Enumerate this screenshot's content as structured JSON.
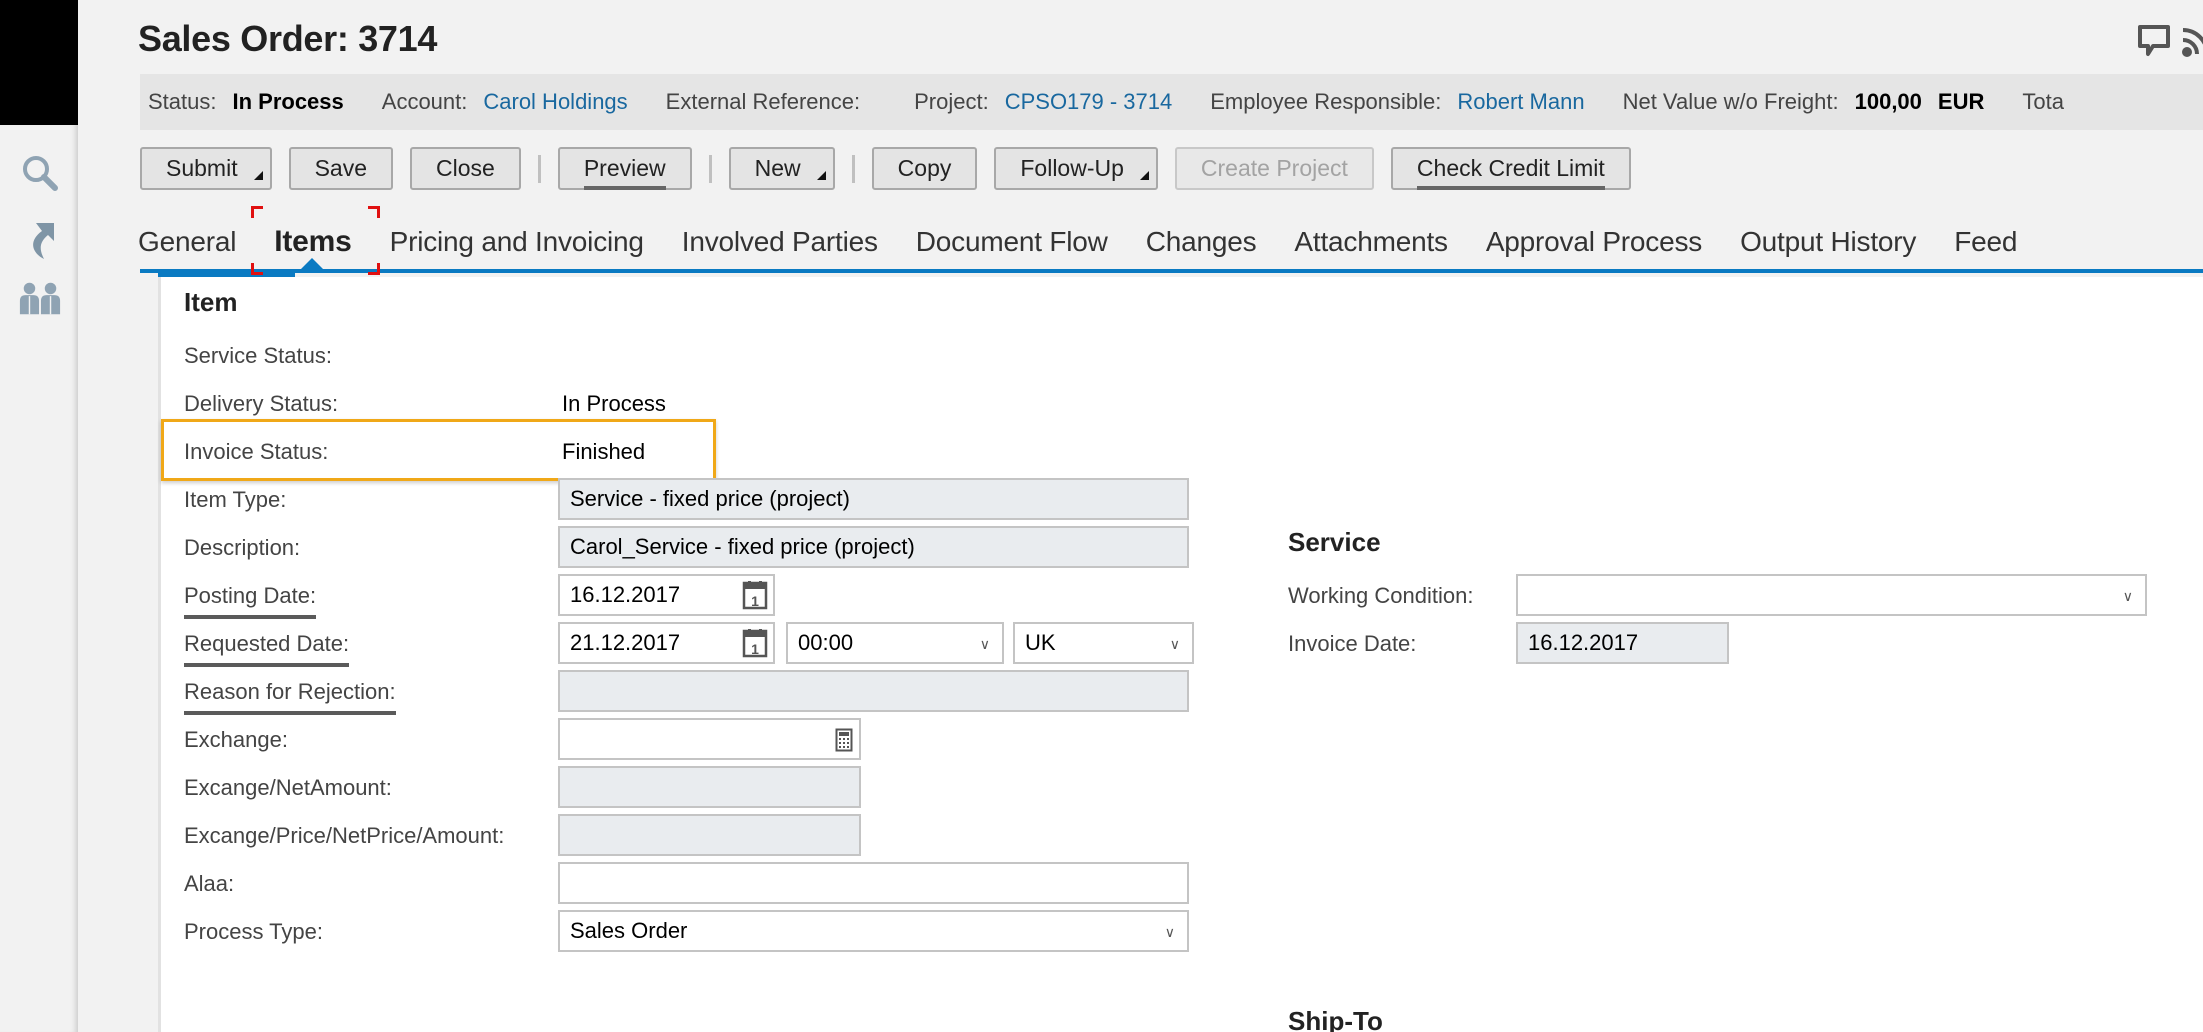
{
  "title": "Sales Order: 3714",
  "header_bar": {
    "status_label": "Status:",
    "status_value": "In Process",
    "account_label": "Account:",
    "account_value": "Carol Holdings",
    "external_ref_label": "External Reference:",
    "external_ref_value": "",
    "project_label": "Project:",
    "project_value": "CPSO179 - 3714",
    "employee_label": "Employee Responsible:",
    "employee_value": "Robert Mann",
    "net_value_label": "Net Value w/o Freight:",
    "net_value_amount": "100,00",
    "net_value_currency": "EUR",
    "total_label_partial": "Tota"
  },
  "toolbar": {
    "submit": "Submit",
    "save": "Save",
    "close": "Close",
    "preview": "Preview",
    "new": "New",
    "copy": "Copy",
    "follow_up": "Follow-Up",
    "create_project": "Create Project",
    "check_credit_limit": "Check Credit Limit"
  },
  "tabs": [
    {
      "label": "General",
      "active": false
    },
    {
      "label": "Items",
      "active": true
    },
    {
      "label": "Pricing and Invoicing",
      "active": false
    },
    {
      "label": "Involved Parties",
      "active": false
    },
    {
      "label": "Document Flow",
      "active": false
    },
    {
      "label": "Changes",
      "active": false
    },
    {
      "label": "Attachments",
      "active": false
    },
    {
      "label": "Approval Process",
      "active": false
    },
    {
      "label": "Output History",
      "active": false
    },
    {
      "label": "Feed",
      "active": false
    }
  ],
  "item_section": {
    "title": "Item",
    "service_status_label": "Service Status:",
    "service_status_value": "",
    "delivery_status_label": "Delivery Status:",
    "delivery_status_value": "In Process",
    "invoice_status_label": "Invoice Status:",
    "invoice_status_value": "Finished",
    "item_type_label": "Item Type:",
    "item_type_value": "Service - fixed price (project)",
    "description_label": "Description:",
    "description_value": "Carol_Service - fixed price (project)",
    "posting_date_label": "Posting Date:",
    "posting_date_value": "16.12.2017",
    "requested_date_label": "Requested Date:",
    "requested_date_value": "21.12.2017",
    "requested_time_value": "00:00",
    "requested_timezone_value": "UK",
    "reason_rejection_label": "Reason for Rejection:",
    "reason_rejection_value": "",
    "exchange_label": "Exchange:",
    "exchange_value": "",
    "exchange_net_label": "Excange/NetAmount:",
    "exchange_net_value": "",
    "exchange_price_label": "Excange/Price/NetPrice/Amount:",
    "exchange_price_value": "",
    "alaa_label": "Alaa:",
    "alaa_value": "",
    "process_type_label": "Process Type:",
    "process_type_value": "Sales Order"
  },
  "service_section": {
    "title": "Service",
    "working_condition_label": "Working Condition:",
    "working_condition_value": "",
    "invoice_date_label": "Invoice Date:",
    "invoice_date_value": "16.12.2017"
  },
  "ship_to_section": {
    "title": "Ship-To"
  },
  "colors": {
    "accent": "#0a7ac2",
    "link": "#19689f",
    "highlight": "#f0a818",
    "focus": "#e01010"
  }
}
